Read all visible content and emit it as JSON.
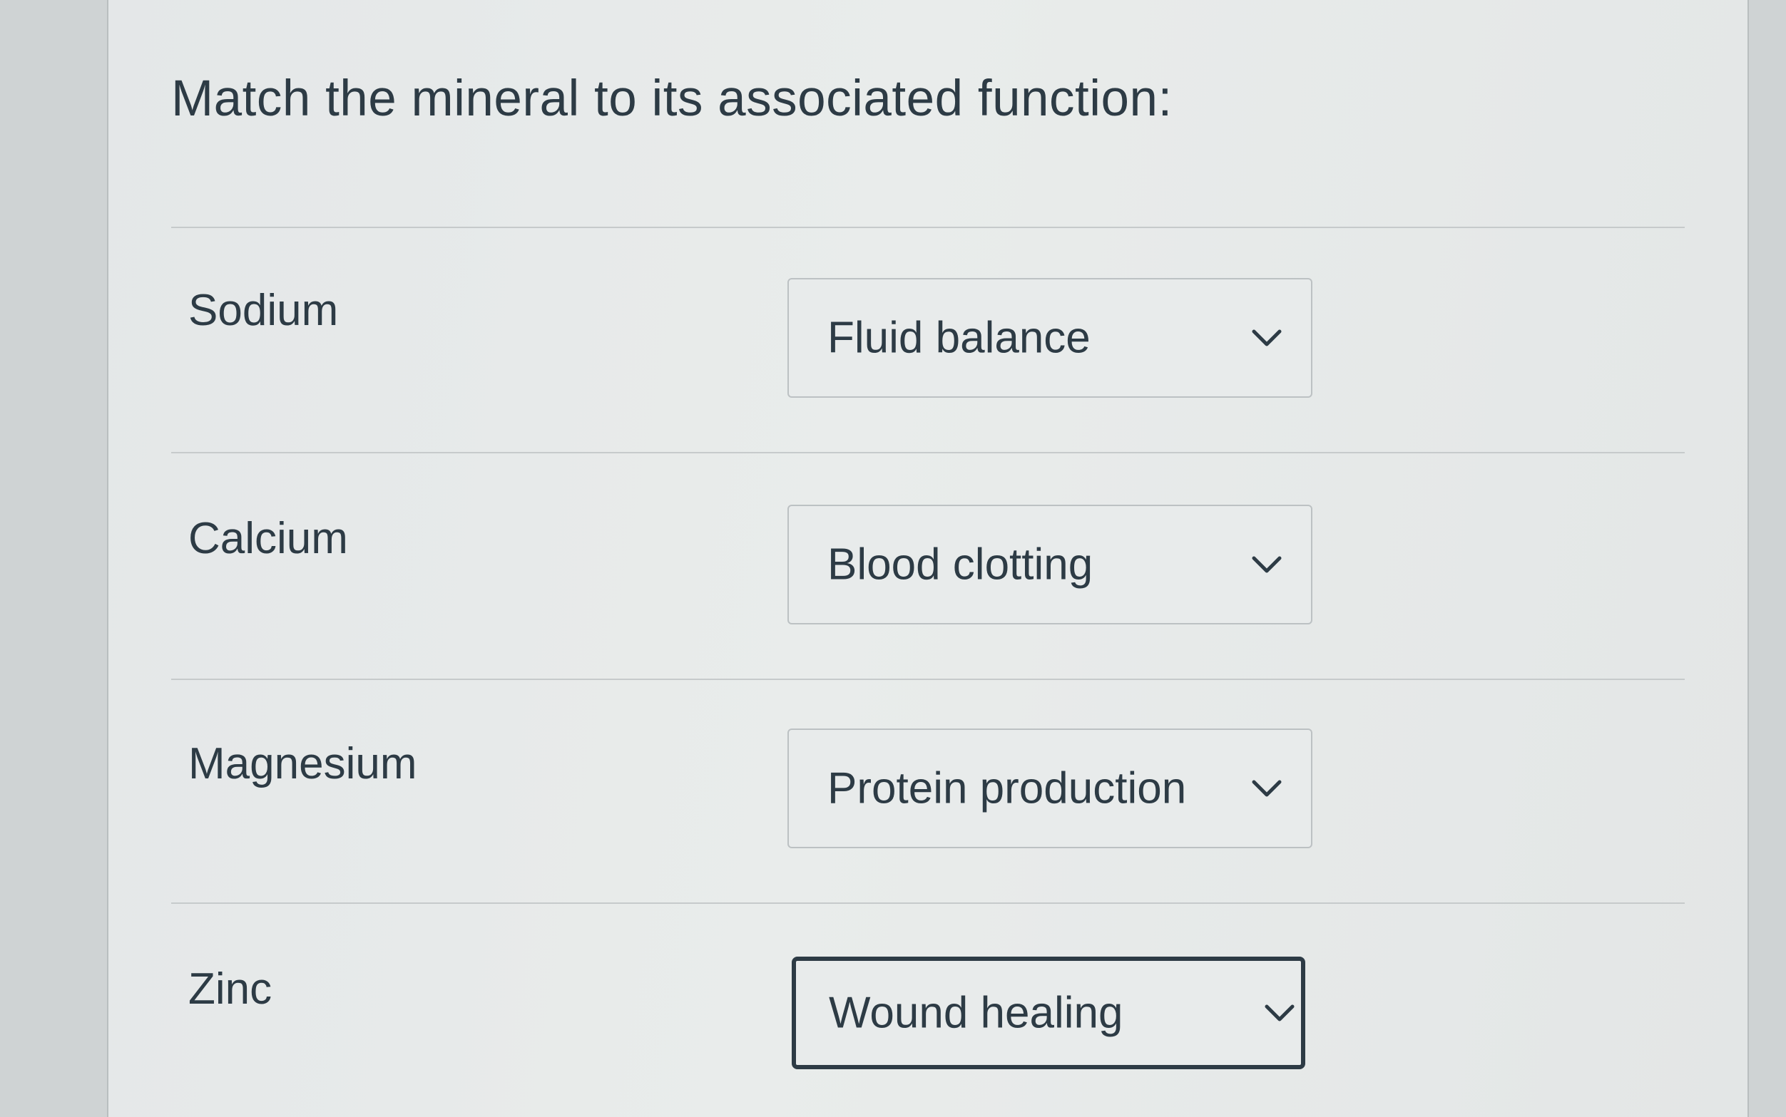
{
  "question": {
    "text": "Match the mineral to its associated function:"
  },
  "rows": [
    {
      "mineral": "Sodium",
      "selected": "Fluid balance"
    },
    {
      "mineral": "Calcium",
      "selected": "Blood clotting"
    },
    {
      "mineral": "Magnesium",
      "selected": "Protein production"
    },
    {
      "mineral": "Zinc",
      "selected": "Wound healing"
    }
  ],
  "icons": {
    "dropdown": "chevron-down-icon"
  },
  "colors": {
    "text": "#2d3b45",
    "border": "#bcc1c3",
    "focus_border": "#2d3b45"
  }
}
